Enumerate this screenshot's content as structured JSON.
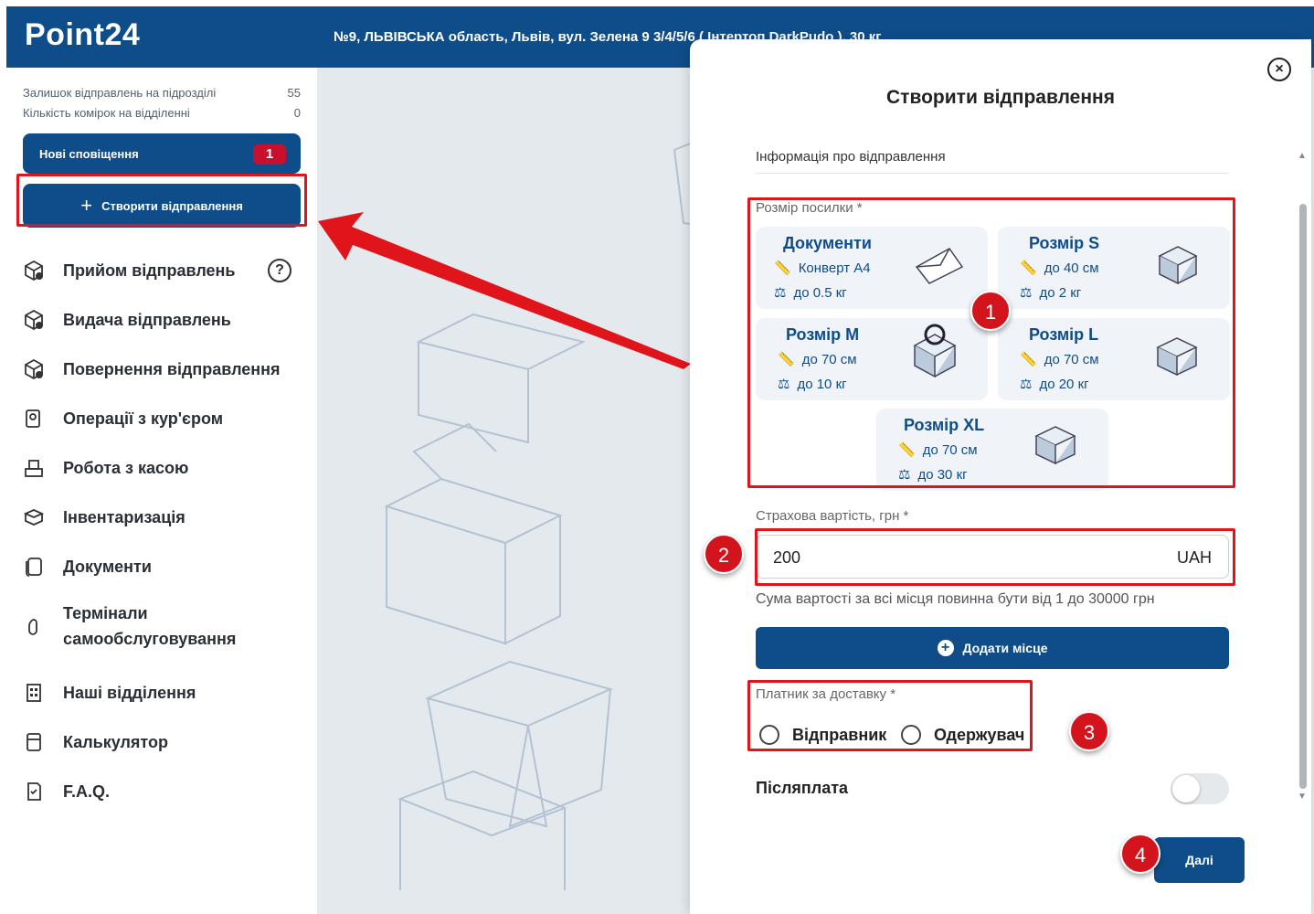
{
  "app": {
    "logo": "Point24",
    "address": "№9, ЛЬВІВСЬКА область, Львів, вул. Зелена 9 3/4/5/6 ( Інтертоп DarkPudo ), 30 кг"
  },
  "sidebar": {
    "stats": [
      {
        "label": "Залишок відправлень на підрозділі",
        "value": "55"
      },
      {
        "label": "Кількість комірок на відділенні",
        "value": "0"
      }
    ],
    "notifications": {
      "label": "Нові сповіщення",
      "count": "1"
    },
    "create_button": {
      "icon": "+",
      "label": "Створити відправлення"
    },
    "help_glyph": "?",
    "menu": [
      {
        "label": "Прийом відправлень",
        "icon": "package-in-icon"
      },
      {
        "label": "Видача відправлень",
        "icon": "package-out-icon"
      },
      {
        "label": "Повернення відправлення",
        "icon": "package-return-icon"
      },
      {
        "label": "Операції з кур'єром",
        "icon": "courier-icon"
      },
      {
        "label": "Робота з касою",
        "icon": "cash-register-icon"
      },
      {
        "label": "Інвентаризація",
        "icon": "inventory-icon"
      },
      {
        "label": "Документи",
        "icon": "documents-icon"
      },
      {
        "label": "Термінали",
        "label2": "самообслуговування",
        "icon": "terminal-icon"
      },
      {
        "label": "Наші відділення",
        "icon": "branches-icon"
      },
      {
        "label": "Калькулятор",
        "icon": "calculator-icon"
      },
      {
        "label": "F.A.Q.",
        "icon": "faq-icon"
      }
    ]
  },
  "modal": {
    "close_glyph": "×",
    "title": "Створити відправлення",
    "section": "Інформація про відправлення",
    "size_label": "Розмір посилки *",
    "sizes": [
      {
        "title": "Документи",
        "dim": "Конверт А4",
        "weight": "до 0.5 кг"
      },
      {
        "title": "Розмір S",
        "dim": "до 40 см",
        "weight": "до 2 кг"
      },
      {
        "title": "Розмір M",
        "dim": "до 70 см",
        "weight": "до 10 кг"
      },
      {
        "title": "Розмір L",
        "dim": "до 70 см",
        "weight": "до 20 кг"
      },
      {
        "title": "Розмір XL",
        "dim": "до 70 см",
        "weight": "до 30 кг"
      }
    ],
    "insurance_label": "Страхова вартість, грн *",
    "insurance_value": "200",
    "insurance_currency": "UAH",
    "insurance_hint": "Сума вартості за всі місця повинна бути від 1 до 30000 грн",
    "add_place": {
      "icon": "+",
      "label": "Додати місце"
    },
    "payer_label": "Платник за доставку *",
    "payer_options": [
      "Відправник",
      "Одержувач"
    ],
    "cod_label": "Післяплата",
    "next": "Далі"
  },
  "annotations": [
    "1",
    "2",
    "3",
    "4"
  ],
  "colors": {
    "brand": "#0f4d8a",
    "highlight": "#e0151b",
    "badge": "#c8102e"
  }
}
